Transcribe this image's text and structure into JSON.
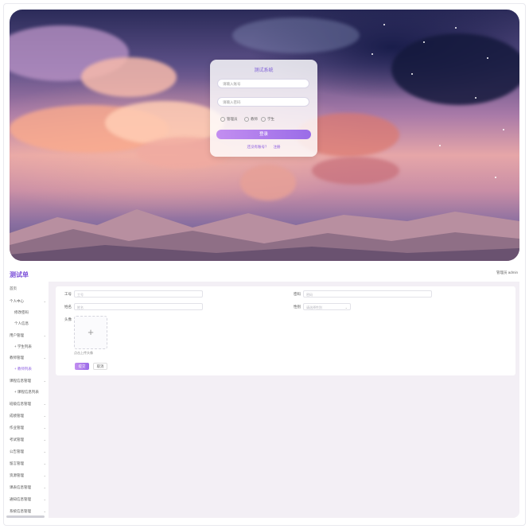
{
  "login": {
    "title": "测试系统",
    "username_placeholder": "请输入账号",
    "password_placeholder": "请输入密码",
    "roles": [
      "管理员",
      "教师",
      "学生"
    ],
    "submit_label": "登录",
    "links": [
      "还没有账号？",
      "注册"
    ]
  },
  "app": {
    "brand": "测试单",
    "user": "管理员 admin"
  },
  "sidebar": {
    "items": [
      {
        "label": "首页",
        "sub": false,
        "chevron": false
      },
      {
        "label": "个人中心",
        "sub": false,
        "chevron": true
      },
      {
        "label": "修改密码",
        "sub": true,
        "chevron": false
      },
      {
        "label": "个人信息",
        "sub": true,
        "chevron": false
      },
      {
        "label": "用户管理",
        "sub": false,
        "chevron": true
      },
      {
        "label": "学生列表",
        "sub": true,
        "chevron": false
      },
      {
        "label": "教师管理",
        "sub": false,
        "chevron": true
      },
      {
        "label": "教师列表",
        "sub": true,
        "chevron": false,
        "active": true
      },
      {
        "label": "课程信息管理",
        "sub": false,
        "chevron": true
      },
      {
        "label": "课程信息列表",
        "sub": true,
        "chevron": false
      },
      {
        "label": "班级信息管理",
        "sub": false,
        "chevron": true
      },
      {
        "label": "成绩管理",
        "sub": false,
        "chevron": true
      },
      {
        "label": "作业管理",
        "sub": false,
        "chevron": true
      },
      {
        "label": "考试管理",
        "sub": false,
        "chevron": true
      },
      {
        "label": "公告管理",
        "sub": false,
        "chevron": true
      },
      {
        "label": "留言管理",
        "sub": false,
        "chevron": true
      },
      {
        "label": "资源管理",
        "sub": false,
        "chevron": true
      },
      {
        "label": "课表信息管理",
        "sub": false,
        "chevron": true
      },
      {
        "label": "通知信息管理",
        "sub": false,
        "chevron": true
      },
      {
        "label": "系统信息管理",
        "sub": false,
        "chevron": true
      }
    ]
  },
  "form": {
    "account_label": "工号",
    "account_placeholder": "工号",
    "password_label": "密码",
    "password_placeholder": "密码",
    "name_label": "姓名",
    "name_placeholder": "姓名",
    "gender_label": "性别",
    "gender_placeholder": "请选择性别",
    "avatar_label": "头像",
    "upload_plus": "+",
    "upload_tip": "点击上传头像",
    "submit_label": "提交",
    "reset_label": "取消"
  }
}
